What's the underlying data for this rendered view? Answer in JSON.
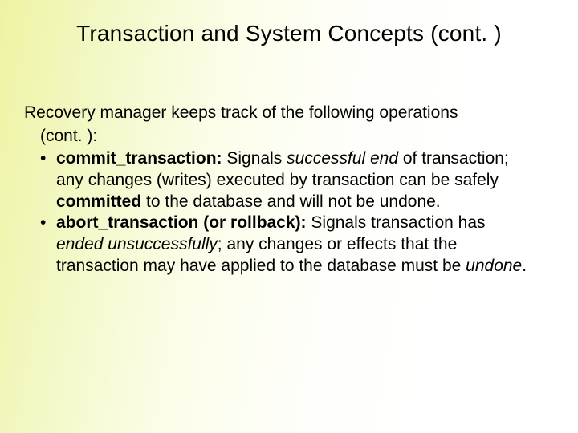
{
  "title": "Transaction and System Concepts (cont. )",
  "intro_line1": "Recovery manager keeps track of the following operations",
  "intro_line2": "(cont. ):",
  "bullets": [
    {
      "label": "commit_transaction:",
      "t1": " Signals ",
      "em1": "successful end",
      "t2": " of transaction; any changes (writes) executed by transaction can be safely ",
      "strong1": "committed",
      "t3": " to the database and will not be undone."
    },
    {
      "label": "abort_transaction (or rollback):",
      "t1": " Signals transaction has ",
      "em1": "ended unsuccessfully",
      "t2": "; any changes or effects that the transaction may have applied to the database must be ",
      "em2": "undone",
      "t3": "."
    }
  ]
}
